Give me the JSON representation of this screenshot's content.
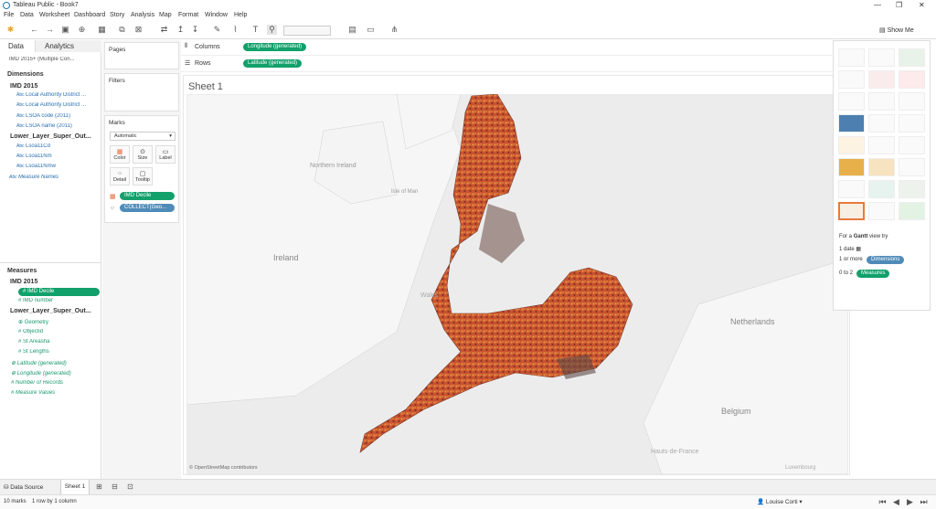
{
  "window": {
    "title": "Tableau Public - Book7",
    "minimize": "—",
    "maximize": "❐",
    "close": "✕"
  },
  "menu": [
    "File",
    "Data",
    "Worksheet",
    "Dashboard",
    "Story",
    "Analysis",
    "Map",
    "Format",
    "Window",
    "Help"
  ],
  "toolbar": {
    "show_me": "Show Me"
  },
  "left": {
    "tab_data": "Data",
    "tab_analytics": "Analytics",
    "datasource": "IMD 2015+ (Multiple Con...",
    "dimensions_header": "Dimensions",
    "dim_groups": [
      {
        "name": "IMD 2015",
        "fields": [
          "Local Authority District ...",
          "Local Authority District ...",
          "LSOA code (2011)",
          "LSOA name (2011)"
        ]
      },
      {
        "name": "Lower_Layer_Super_Out...",
        "fields": [
          "Lsoa11Cd",
          "Lsoa11Nm",
          "Lsoa11Nmw"
        ]
      }
    ],
    "measure_names": "Measure Names",
    "measures_header": "Measures",
    "measure_group1": "IMD 2015",
    "measure_pill": "IMD Decile",
    "imd_number": "IMD number",
    "measure_group2": "Lower_Layer_Super_Out...",
    "measure_fields2": [
      "Geometry",
      "Objectid",
      "St Areasha",
      "St Lengths"
    ],
    "other_measures": [
      "Latitude (generated)",
      "Longitude (generated)",
      "Number of Records",
      "Measure Values"
    ]
  },
  "cards": {
    "pages": "Pages",
    "filters": "Filters",
    "marks": "Marks",
    "mark_type": "Automatic",
    "color": "Color",
    "size": "Size",
    "label": "Label",
    "detail": "Detail",
    "tooltip": "Tooltip",
    "pill_decile": "IMD Decile",
    "pill_collect": "COLLECT(Geo..."
  },
  "shelves": {
    "columns_label": "Columns",
    "columns_pill": "Longitude (generated)",
    "rows_label": "Rows",
    "rows_pill": "Latitude (generated)"
  },
  "sheet": {
    "title": "Sheet 1",
    "attribution": "© OpenStreetMap contributors",
    "places": [
      "Northern Ireland",
      "Isle of Man",
      "Ireland",
      "Wales",
      "Netherlands",
      "Belgium",
      "Hauts-de-France",
      "Luxembourg"
    ]
  },
  "showme": {
    "hint_prefix": "For a",
    "hint_type": "Gantt",
    "hint_suffix": "view try",
    "req1": "1 date",
    "req2_prefix": "1 or more",
    "req2_pill": "Dimensions",
    "req3_prefix": "0 to 2",
    "req3_pill": "Measures"
  },
  "bottom": {
    "data_source_tab": "Data Source",
    "sheet_tab": "Sheet 1"
  },
  "status": {
    "marks": "10 marks",
    "rows_cols": "1 row by 1 column",
    "user": "Louise Corti"
  },
  "colors": {
    "accent_green": "#12a06b",
    "accent_blue": "#4f8bb8"
  }
}
